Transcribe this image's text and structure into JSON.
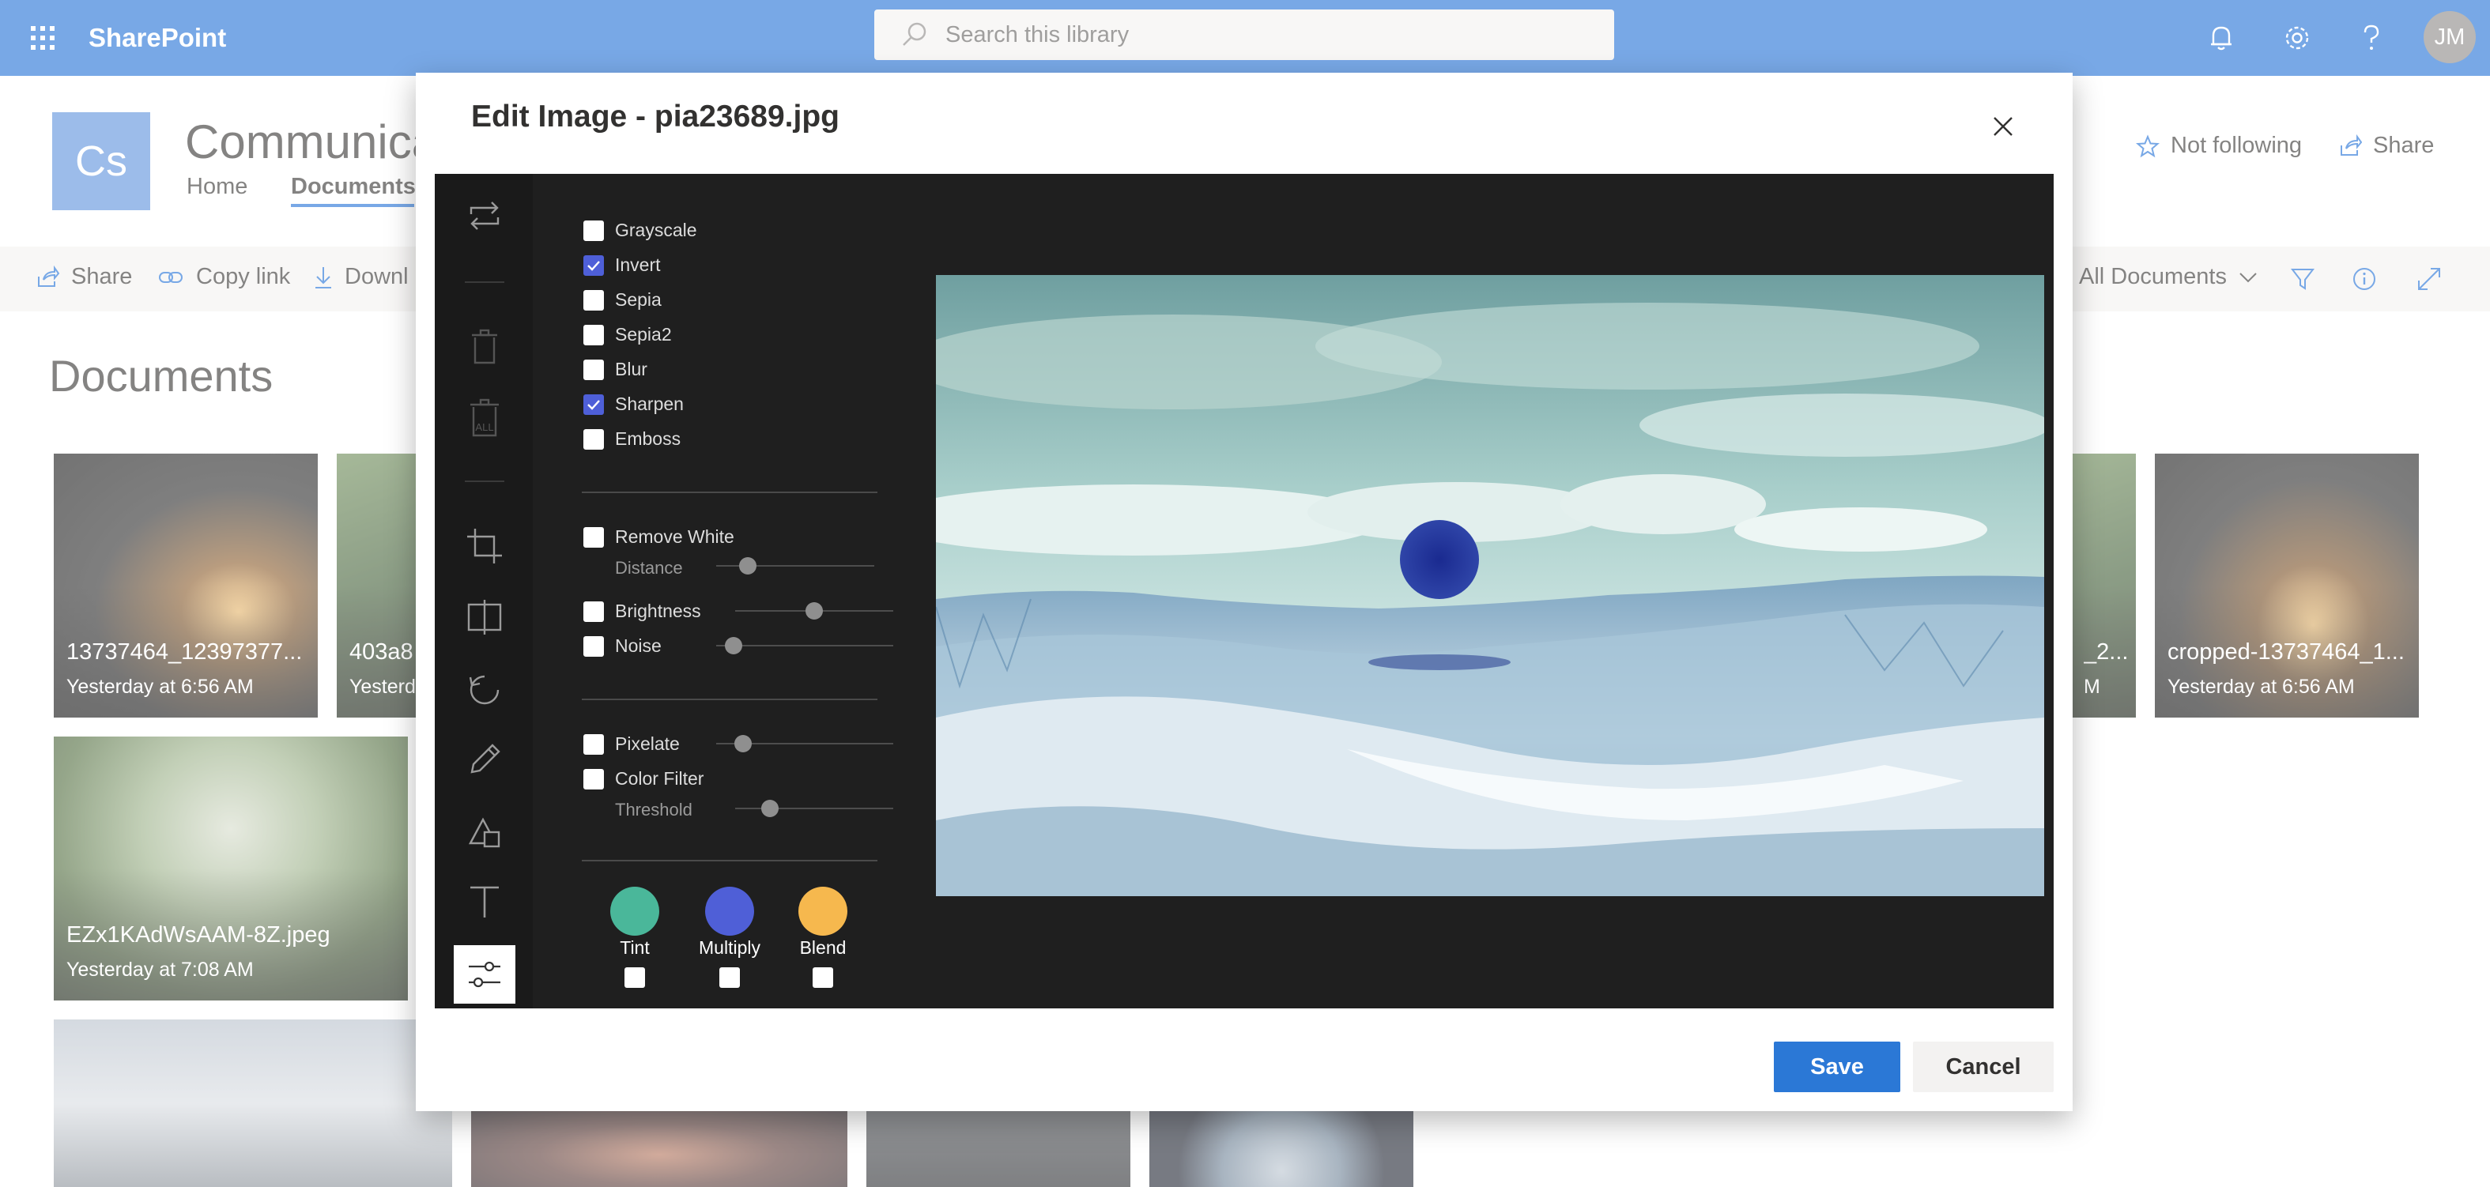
{
  "suite_bar": {
    "app_name": "SharePoint",
    "search_placeholder": "Search this library",
    "avatar_initials": "JM",
    "icons": [
      "waffle-icon",
      "search-icon",
      "bell-icon",
      "gear-icon",
      "help-icon"
    ]
  },
  "site": {
    "logo_initials": "Cs",
    "title": "Communicat",
    "nav": [
      "Home",
      "Documents"
    ],
    "active_nav": "Documents",
    "follow_label": "Not following",
    "share_label": "Share"
  },
  "command_bar": {
    "share": "Share",
    "copy_link": "Copy link",
    "download": "Downl",
    "view": "All Documents"
  },
  "library": {
    "title": "Documents",
    "tiles": [
      {
        "name": "13737464_12397377...",
        "date": "Yesterday at 6:56 AM"
      },
      {
        "name": "403a8",
        "date": "Yesterd"
      },
      {
        "name": "_2...",
        "date": "M"
      },
      {
        "name": "cropped-13737464_1...",
        "date": "Yesterday at 6:56 AM"
      },
      {
        "name": "EZx1KAdWsAAM-8Z.jpeg",
        "date": "Yesterday at 7:08 AM"
      }
    ]
  },
  "dialog": {
    "title": "Edit Image - pia23689.jpg",
    "filters": [
      {
        "label": "Grayscale",
        "checked": false
      },
      {
        "label": "Invert",
        "checked": true
      },
      {
        "label": "Sepia",
        "checked": false
      },
      {
        "label": "Sepia2",
        "checked": false
      },
      {
        "label": "Blur",
        "checked": false
      },
      {
        "label": "Sharpen",
        "checked": true
      },
      {
        "label": "Emboss",
        "checked": false
      }
    ],
    "adjust": {
      "remove_white": "Remove White",
      "distance": "Distance",
      "brightness": "Brightness",
      "noise": "Noise",
      "pixelate": "Pixelate",
      "color_filter": "Color Filter",
      "threshold": "Threshold"
    },
    "slider_levels": {
      "distance": 0.2,
      "brightness": 0.5,
      "noise": 0.1,
      "pixelate": 0.15,
      "threshold": 0.22
    },
    "blend_modes": [
      {
        "label": "Tint",
        "color": "#4ab79a"
      },
      {
        "label": "Multiply",
        "color": "#4f5fd7"
      },
      {
        "label": "Blend",
        "color": "#f6b84e"
      }
    ],
    "save_label": "Save",
    "cancel_label": "Cancel"
  },
  "colors": {
    "suite_bar": "#1e6fd6",
    "primary_button": "#2b78d6",
    "checkbox_checked": "#4e5fd8",
    "editor_bg": "#1f1f1f"
  }
}
